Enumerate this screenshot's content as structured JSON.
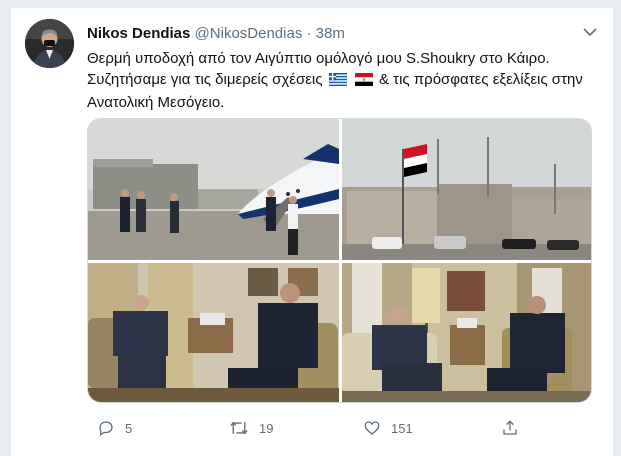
{
  "tweet": {
    "author_name": "Nikos Dendias",
    "handle": "@NikosDendias",
    "separator": "·",
    "time": "38m",
    "text_line1": "Θερμή υποδοχή από τον Αιγύπτιο ομόλογό μου S.Shoukry στο Κάιρο.",
    "text_line2a": "Συζητήσαμε για τις διμερείς σχέσεις",
    "text_line2b": "& τις πρόσφατες εξελίξεις στην",
    "text_line3": "Ανατολική Μεσόγειο.",
    "flags": [
      "greece-flag",
      "egypt-flag"
    ]
  },
  "media": {
    "photos": [
      "photo-plane-arrival",
      "photo-ministry-building",
      "photo-meeting-left",
      "photo-meeting-right"
    ]
  },
  "actions": {
    "reply_count": "5",
    "retweet_count": "19",
    "like_count": "151",
    "icons": [
      "reply-icon",
      "retweet-icon",
      "like-icon",
      "share-icon"
    ]
  },
  "colors": {
    "secondary_text": "#5b7083",
    "background": "#e6ecf0",
    "card": "#ffffff"
  }
}
